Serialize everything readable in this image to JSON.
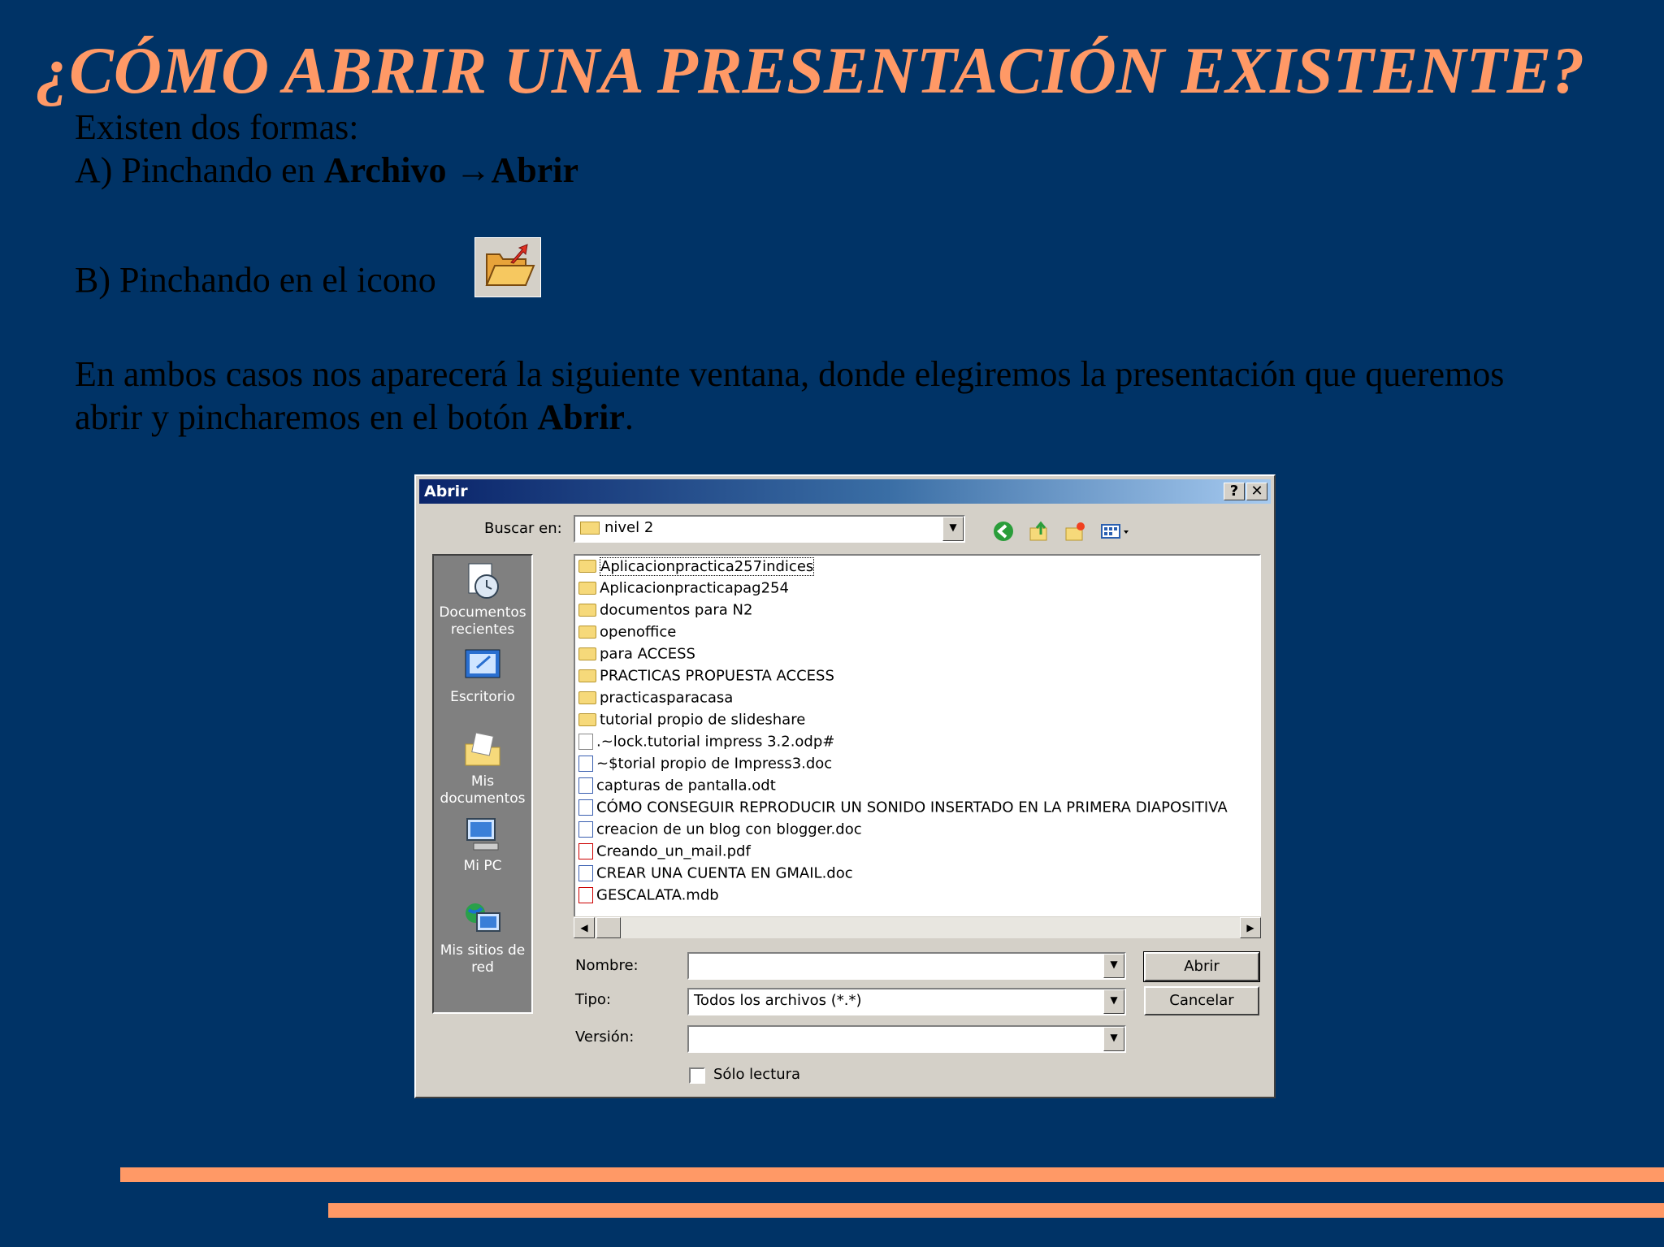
{
  "slide": {
    "title": "¿CÓMO ABRIR UNA PRESENTACIÓN EXISTENTE?",
    "line1": "Existen dos formas:",
    "line2_prefix": "A) Pinchando en ",
    "line2_bold": "Archivo →Abrir",
    "line3": "B) Pinchando en el icono",
    "line4": "En ambos casos nos aparecerá la siguiente ventana, donde elegiremos la presentación que queremos",
    "line5_prefix": "abrir y pincharemos en el botón ",
    "line5_bold": "Abrir",
    "line5_suffix": "."
  },
  "dialog": {
    "title": "Abrir",
    "help_button": "?",
    "close_button": "✕",
    "lookin_label": "Buscar en:",
    "lookin_value": "nivel 2",
    "places": [
      {
        "label": "Documentos recientes",
        "icon": "recent-documents-icon"
      },
      {
        "label": "Escritorio",
        "icon": "desktop-icon"
      },
      {
        "label": "Mis documentos",
        "icon": "my-documents-icon"
      },
      {
        "label": "Mi PC",
        "icon": "my-computer-icon"
      },
      {
        "label": "Mis sitios de red",
        "icon": "network-places-icon"
      }
    ],
    "files": [
      {
        "name": "Aplicacionpractica257indices",
        "type": "folder"
      },
      {
        "name": "Aplicacionpracticapag254",
        "type": "folder"
      },
      {
        "name": "documentos para N2",
        "type": "folder"
      },
      {
        "name": "openoffice",
        "type": "folder"
      },
      {
        "name": "para ACCESS",
        "type": "folder"
      },
      {
        "name": "PRACTICAS PROPUESTA ACCESS",
        "type": "folder"
      },
      {
        "name": "practicasparacasa",
        "type": "folder"
      },
      {
        "name": "tutorial propio de slideshare",
        "type": "folder"
      },
      {
        "name": ".~lock.tutorial impress 3.2.odp#",
        "type": "file"
      },
      {
        "name": "~$torial propio de Impress3.doc",
        "type": "doc"
      },
      {
        "name": "capturas de pantalla.odt",
        "type": "doc"
      },
      {
        "name": "CÓMO CONSEGUIR REPRODUCIR UN SONIDO INSERTADO EN LA PRIMERA DIAPOSITIVA",
        "type": "doc"
      },
      {
        "name": "creacion de un blog con blogger.doc",
        "type": "doc"
      },
      {
        "name": "Creando_un_mail.pdf",
        "type": "pdf"
      },
      {
        "name": "CREAR UNA CUENTA EN GMAIL.doc",
        "type": "doc"
      },
      {
        "name": "GESCALATA.mdb",
        "type": "pdf"
      }
    ],
    "nombre_label": "Nombre:",
    "nombre_value": "",
    "tipo_label": "Tipo:",
    "tipo_value": "Todos los archivos (*.*)",
    "version_label": "Versión:",
    "version_value": "",
    "readonly_label": "Sólo lectura",
    "open_button": "Abrir",
    "cancel_button": "Cancelar"
  },
  "colors": {
    "background": "#003366",
    "accent": "#FF9966"
  }
}
